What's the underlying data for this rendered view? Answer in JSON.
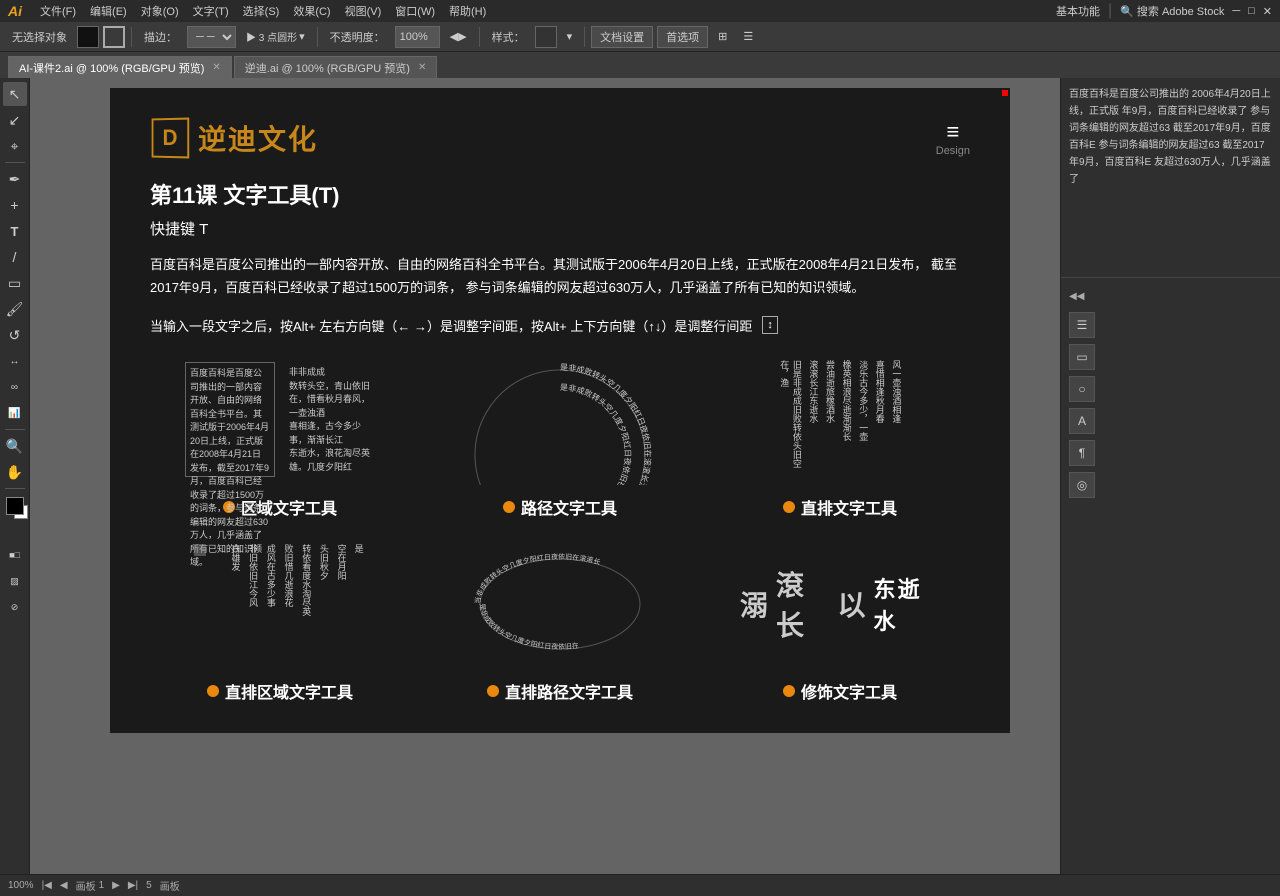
{
  "app": {
    "logo": "Ai",
    "logo_color": "#e8a020"
  },
  "menu": {
    "items": [
      "文件(F)",
      "编辑(E)",
      "对象(O)",
      "文字(T)",
      "选择(S)",
      "效果(C)",
      "视图(V)",
      "窗口(W)",
      "帮助(H)"
    ],
    "right_items": [
      "基本功能",
      "搜索 Adobe Stock"
    ]
  },
  "toolbar": {
    "no_select": "无选择对象",
    "stroke": "描边：",
    "points_label": "▶  3  点圆形",
    "opacity_label": "不透明度：",
    "opacity_value": "100%",
    "style_label": "样式：",
    "doc_settings": "文档设置",
    "preferences": "首选项"
  },
  "tabs": [
    {
      "label": "AI-课件2.ai @ 100% (RGB/GPU 预览)",
      "active": true
    },
    {
      "label": "逆迪.ai @ 100% (RGB/GPU 预览)",
      "active": false
    }
  ],
  "doc": {
    "logo_symbol": "D",
    "logo_name": "逆迪文化",
    "design_label": "Design",
    "hamburger": "≡",
    "lesson_title": "第11课   文字工具(T)",
    "shortcut": "快捷键 T",
    "description": "百度百科是百度公司推出的一部内容开放、自由的网络百科全书平台。其测试版于2006年4月20日上线，正式版在2008年4月21日发布，\n截至2017年9月，百度百科已经收录了超过1500万的词条，\n参与词条编辑的网友超过630万人，几乎涵盖了所有已知的知识领域。",
    "tip": "当输入一段文字之后，按Alt+ 左右方向键（← →）是调整字间距，按Alt+ 上下方向键（↑↓）是调整行间距",
    "area_text_label": "区域文字工具",
    "path_text_label": "路径文字工具",
    "vertical_text_label": "直排文字工具",
    "vertical_area_label": "直排区域文字工具",
    "vertical_path_label": "直排路径文字工具",
    "decoration_label": "修饰文字工具",
    "area_content": "百度百科是百度公司推出的一部内容开放、自由的网络百科全书平台。其测试版于2006年4月20日上线，正式版在2008年4月21日发布，截至2017年9月，百度百科已经收录了超过1500万的词条，参与词条编辑的网友超过630万人，几乎涵盖了所有已知的知识领域。",
    "area_content2": "非非成成\n数转头空，青山依旧\n在，惜看秋月春风，一壶浊酒\n喜相逢，古今多少事，渐渐长江\n东逝水，浪花淘尽英雄。几度夕阳红，日夜滚滚长江东\n逝水，是非成败转头空，青山依旧在，几度夕阳红，日夜滚滚长江上，惜看秋月橡",
    "vertical_content": "旧是非\n是成成\n依败转\n旧转头\n在头空\n，空青\n渔\n滚\n滚\n长\n江\n东\n逝\n水",
    "vertical_content2": "旅油逝\n橡酒水",
    "circle_text": "是非成败转头空几度夕阳红日夜依旧在滚滚长江东逝水",
    "circle_text2": "是非成败转头空几度夕阳红日夜依旧在"
  },
  "right_panel": {
    "text": "百度百科是百度公司推出的\n2006年4月20日上线，正式版\n年9月，百度百科已经收录了\n参与词条编辑的网友超过63\n截至2017年9月，百度百科E\n参与词条编辑的网友超过63\n截至2017年9月，百度百科E\n友超过630万人，几乎涵盖了"
  },
  "status": {
    "zoom": "100%",
    "page_label": "画板",
    "page_num": "1",
    "total": "5"
  }
}
